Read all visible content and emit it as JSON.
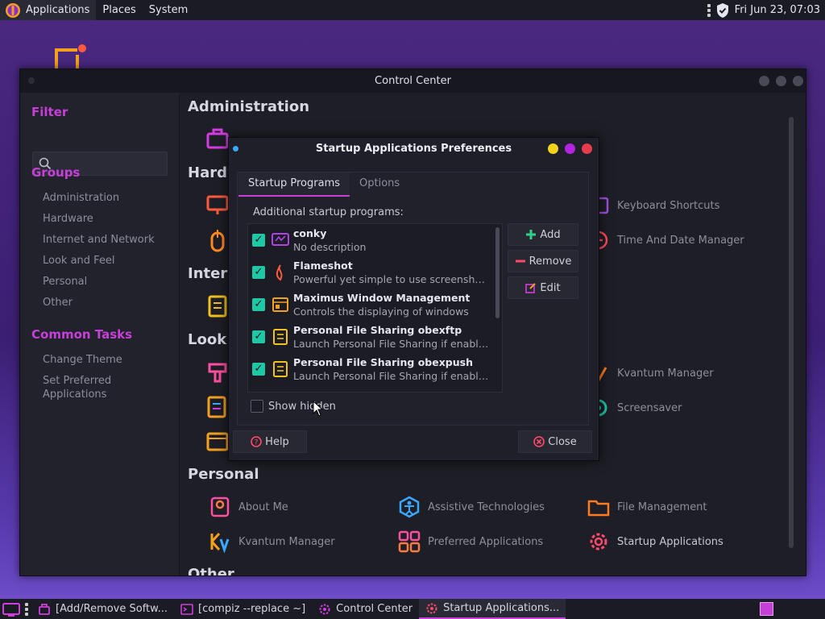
{
  "top_panel": {
    "menus": [
      "Applications",
      "Places",
      "System"
    ],
    "clock": "Fri Jun 23, 07:03"
  },
  "control_center": {
    "title": "Control Center",
    "sidebar": {
      "filter_heading": "Filter",
      "groups_heading": "Groups",
      "groups": [
        "Administration",
        "Hardware",
        "Internet and Network",
        "Look and Feel",
        "Personal",
        "Other"
      ],
      "tasks_heading": "Common Tasks",
      "tasks": [
        "Change Theme",
        "Set Preferred\nApplications"
      ]
    },
    "sections": {
      "administration": "Administration",
      "hardware": "Hardw",
      "internet": "Intern",
      "look": "Look",
      "personal": "Personal",
      "other": "Other"
    },
    "visible_items": {
      "keyboard_shortcuts": "Keyboard Shortcuts",
      "time_date": "Time And Date Manager",
      "kvantum_look": "Kvantum Manager",
      "screensaver": "Screensaver",
      "about_me": "About Me",
      "assistive": "Assistive Technologies",
      "file_management": "File Management",
      "kvantum_personal": "Kvantum Manager",
      "preferred_apps": "Preferred Applications",
      "startup_apps": "Startup Applications"
    }
  },
  "dialog": {
    "title": "Startup Applications Preferences",
    "tabs": [
      "Startup Programs",
      "Options"
    ],
    "list_label": "Additional startup programs:",
    "programs": [
      {
        "name": "conky",
        "desc": "No description",
        "checked": true
      },
      {
        "name": "Flameshot",
        "desc": "Powerful yet simple to use screenshot software",
        "checked": true
      },
      {
        "name": "Maximus Window Management",
        "desc": "Controls the displaying of windows",
        "checked": true
      },
      {
        "name": "Personal File Sharing obexftp",
        "desc": "Launch Personal File Sharing if enabled",
        "checked": true
      },
      {
        "name": "Personal File Sharing obexpush",
        "desc": "Launch Personal File Sharing if enabled",
        "checked": true
      }
    ],
    "buttons": {
      "add": "Add",
      "remove": "Remove",
      "edit": "Edit",
      "help": "Help",
      "close": "Close"
    },
    "show_hidden": "Show hidden"
  },
  "taskbar": {
    "tasks": [
      "[Add/Remove Softw...",
      "[compiz --replace ~]",
      "Control Center",
      "Startup Applications..."
    ]
  },
  "colors": {
    "accent": "#c640d8",
    "check": "#1fc7a5",
    "dot_yellow": "#f2d21a",
    "dot_purple": "#b324e0",
    "dot_red": "#e83b4c"
  }
}
